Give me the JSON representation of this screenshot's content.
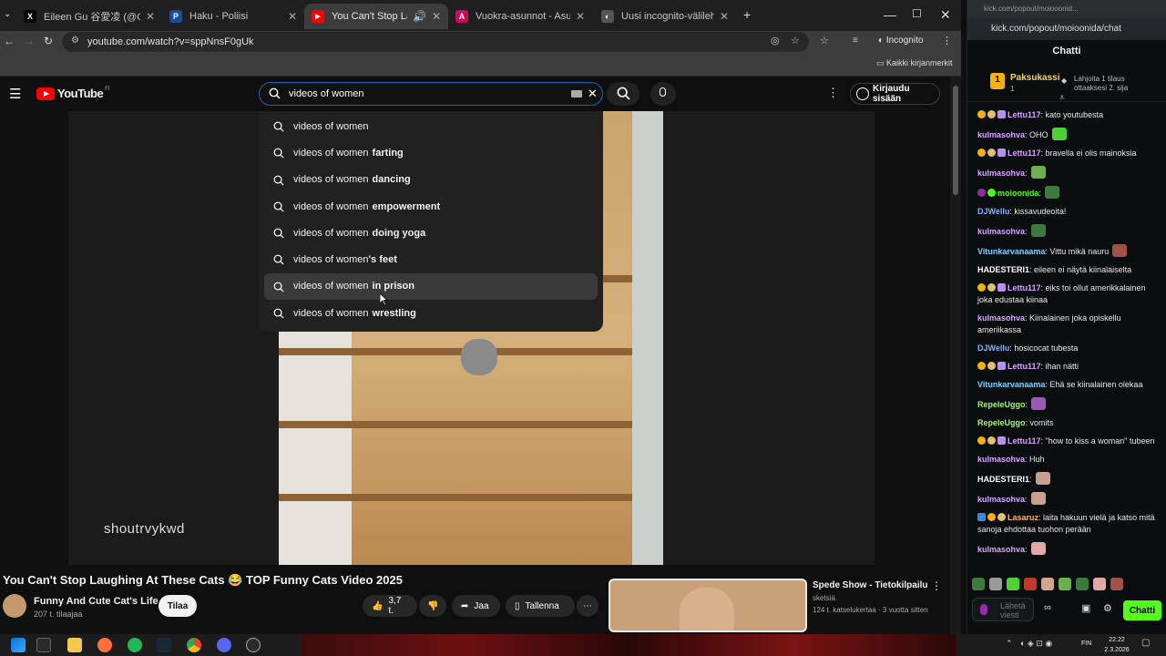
{
  "browser": {
    "tabs": [
      {
        "title": "Eileen Gu 谷愛凌 (@GoEileenGu)",
        "icon": "x-icon",
        "color": "#000000"
      },
      {
        "title": "Haku - Poliisi",
        "icon": "police-icon",
        "color": "#1a4c9c"
      },
      {
        "title": "You Can't Stop Laughing At These Cats",
        "icon": "youtube-icon",
        "color": "#ff0000"
      },
      {
        "title": "Vuokra-asunnot - Asuntohaku",
        "icon": "asuntohaku-icon",
        "color": "#cc0a5a"
      },
      {
        "title": "Uusi incognito-välilehti",
        "icon": "incognito-icon",
        "color": "#555555"
      }
    ],
    "url": "youtube.com/watch?v=sppNnsF0gUk",
    "incognito_label": "Incognito",
    "bookmarks_label": "Kaikki kirjanmerkit"
  },
  "youtube": {
    "logo": "YouTube",
    "region": "FI",
    "search_query": "videos of women",
    "signin_label": "Kirjaudu sisään",
    "suggestions": [
      {
        "prefix": "videos of women",
        "bold": ""
      },
      {
        "prefix": "videos of women",
        "bold": "farting"
      },
      {
        "prefix": "videos of women",
        "bold": "dancing"
      },
      {
        "prefix": "videos of women",
        "bold": "empowerment"
      },
      {
        "prefix": "videos of women",
        "bold": "doing yoga"
      },
      {
        "prefix": "videos of women",
        "bold": "'s feet"
      },
      {
        "prefix": "videos of women",
        "bold": "in prison"
      },
      {
        "prefix": "videos of women",
        "bold": "wrestling"
      }
    ],
    "watermark": "shoutrvykwd",
    "video_title": "You Can't Stop Laughing At These Cats 😂 TOP Funny Cats Video 2025",
    "channel_name": "Funny And Cute Cat's Life",
    "channel_subs": "207 t. tilaajaa",
    "subscribe_label": "Tilaa",
    "like_count": "3,7 t.",
    "share_label": "Jaa",
    "save_label": "Tallenna",
    "related": {
      "title": "Spede Show - Tietokilpailu",
      "channel": "sketsiä",
      "meta": "124 t. katselukertaa · 3 vuotta sitten"
    }
  },
  "kick": {
    "window_title": "kick.com/popout/moiooonid...",
    "url": "kick.com/popout/moioonida/chat",
    "header": "Chatti",
    "pinned_user": "Paksukassi",
    "pinned_count": "1",
    "pinned_text": "Lahjoita 1 tilaus ottaaksesi 2. sija",
    "messages": [
      {
        "user": "Lettu117",
        "color": "#d6a6ff",
        "text": ": kato youtubesta"
      },
      {
        "user": "kulmasohva",
        "color": "#d6a6ff",
        "text": ": OHO"
      },
      {
        "user": "Lettu117",
        "color": "#d6a6ff",
        "text": ": bravella ei olis mainoksia"
      },
      {
        "user": "kulmasohva",
        "color": "#d6a6ff",
        "text": ":"
      },
      {
        "user": "moioonida",
        "color": "#53fc18",
        "text": ":"
      },
      {
        "user": "DJWellu",
        "color": "#7fb3ff",
        "text": ": kissavudeoita!"
      },
      {
        "user": "kulmasohva",
        "color": "#d6a6ff",
        "text": ":"
      },
      {
        "user": "Vitunkarvanaama",
        "color": "#7fd3ff",
        "text": ": Vittu mikä nauru"
      },
      {
        "user": "HADESTERI1",
        "color": "#ffffff",
        "text": ": eileen ei näytä kiinalaiselta"
      },
      {
        "user": "Lettu117",
        "color": "#d6a6ff",
        "text": ": eiks toi ollut amerikkalainen joka edustaa kiinaa"
      },
      {
        "user": "kulmasohva",
        "color": "#d6a6ff",
        "text": ": Kiinalainen joka opiskellu ameriikassa"
      },
      {
        "user": "DJWellu",
        "color": "#7fb3ff",
        "text": ": hosicocat tubesta"
      },
      {
        "user": "Lettu117",
        "color": "#d6a6ff",
        "text": ": ihan nätti"
      },
      {
        "user": "Vitunkarvanaama",
        "color": "#7fd3ff",
        "text": ": Ehä se kiinalainen olekaa"
      },
      {
        "user": "RepeleUggo",
        "color": "#a8f07c",
        "text": ":"
      },
      {
        "user": "RepeleUggo",
        "color": "#a8f07c",
        "text": ": vomits"
      },
      {
        "user": "Lettu117",
        "color": "#d6a6ff",
        "text": ": \"how to kiss a woman\" tubeen"
      },
      {
        "user": "kulmasohva",
        "color": "#d6a6ff",
        "text": ": Huh"
      },
      {
        "user": "HADESTERI1",
        "color": "#ffffff",
        "text": ":"
      },
      {
        "user": "kulmasohva",
        "color": "#d6a6ff",
        "text": ":"
      },
      {
        "user": "Lasaruz",
        "color": "#ffb36b",
        "text": ": laita hakuun vielä ja katso mitä sanoja ehdottaa tuohon perään"
      },
      {
        "user": "kulmasohva",
        "color": "#d6a6ff",
        "text": ":"
      }
    ],
    "input_placeholder": "Lähetä viesti",
    "send_label": "Chatti"
  },
  "taskbar": {
    "language": "FIN",
    "time": "22.22",
    "date": "2.3.2026"
  }
}
